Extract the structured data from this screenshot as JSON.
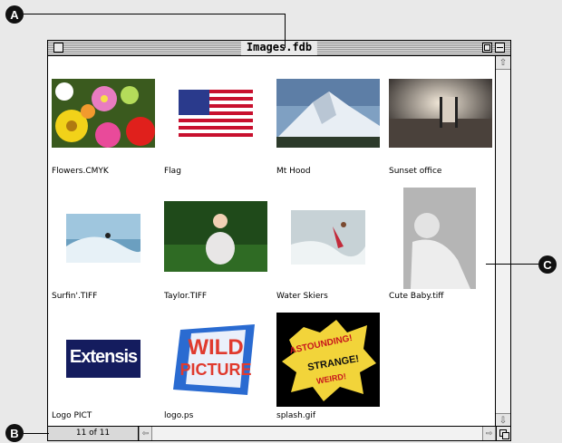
{
  "window": {
    "title": "Images.fdb"
  },
  "callouts": {
    "a": "A",
    "b": "B",
    "c": "C"
  },
  "status": {
    "record_count": "11 of 11"
  },
  "thumbnails": [
    {
      "label": "Flowers.CMYK",
      "icon": "flowers-photo"
    },
    {
      "label": "Flag",
      "icon": "us-flag-photo"
    },
    {
      "label": "Mt Hood",
      "icon": "mountain-photo"
    },
    {
      "label": "Sunset office",
      "icon": "beach-chair-sunset-photo"
    },
    {
      "label": "Surfin'.TIFF",
      "icon": "surfer-photo"
    },
    {
      "label": "Taylor.TIFF",
      "icon": "child-on-grass-photo"
    },
    {
      "label": "Water Skiers",
      "icon": "water-skier-photo"
    },
    {
      "label": "Cute Baby.tiff",
      "icon": "baby-photo"
    },
    {
      "label": "Logo PICT",
      "icon": "extensis-logo"
    },
    {
      "label": "logo.ps",
      "icon": "wild-picture-logo"
    },
    {
      "label": "splash.gif",
      "icon": "astounding-splash-graphic"
    }
  ],
  "logos": {
    "extensis": "Extensis",
    "wild_line1": "WILD",
    "wild_line2": "PICTURE",
    "splash_line1": "ASTOUNDING!",
    "splash_line2": "STRANGE!",
    "splash_line3": "WEIRD!"
  },
  "icons": {
    "scroll_up": "up-arrow-icon",
    "scroll_down": "down-arrow-icon",
    "scroll_left": "left-arrow-icon",
    "scroll_right": "right-arrow-icon"
  }
}
